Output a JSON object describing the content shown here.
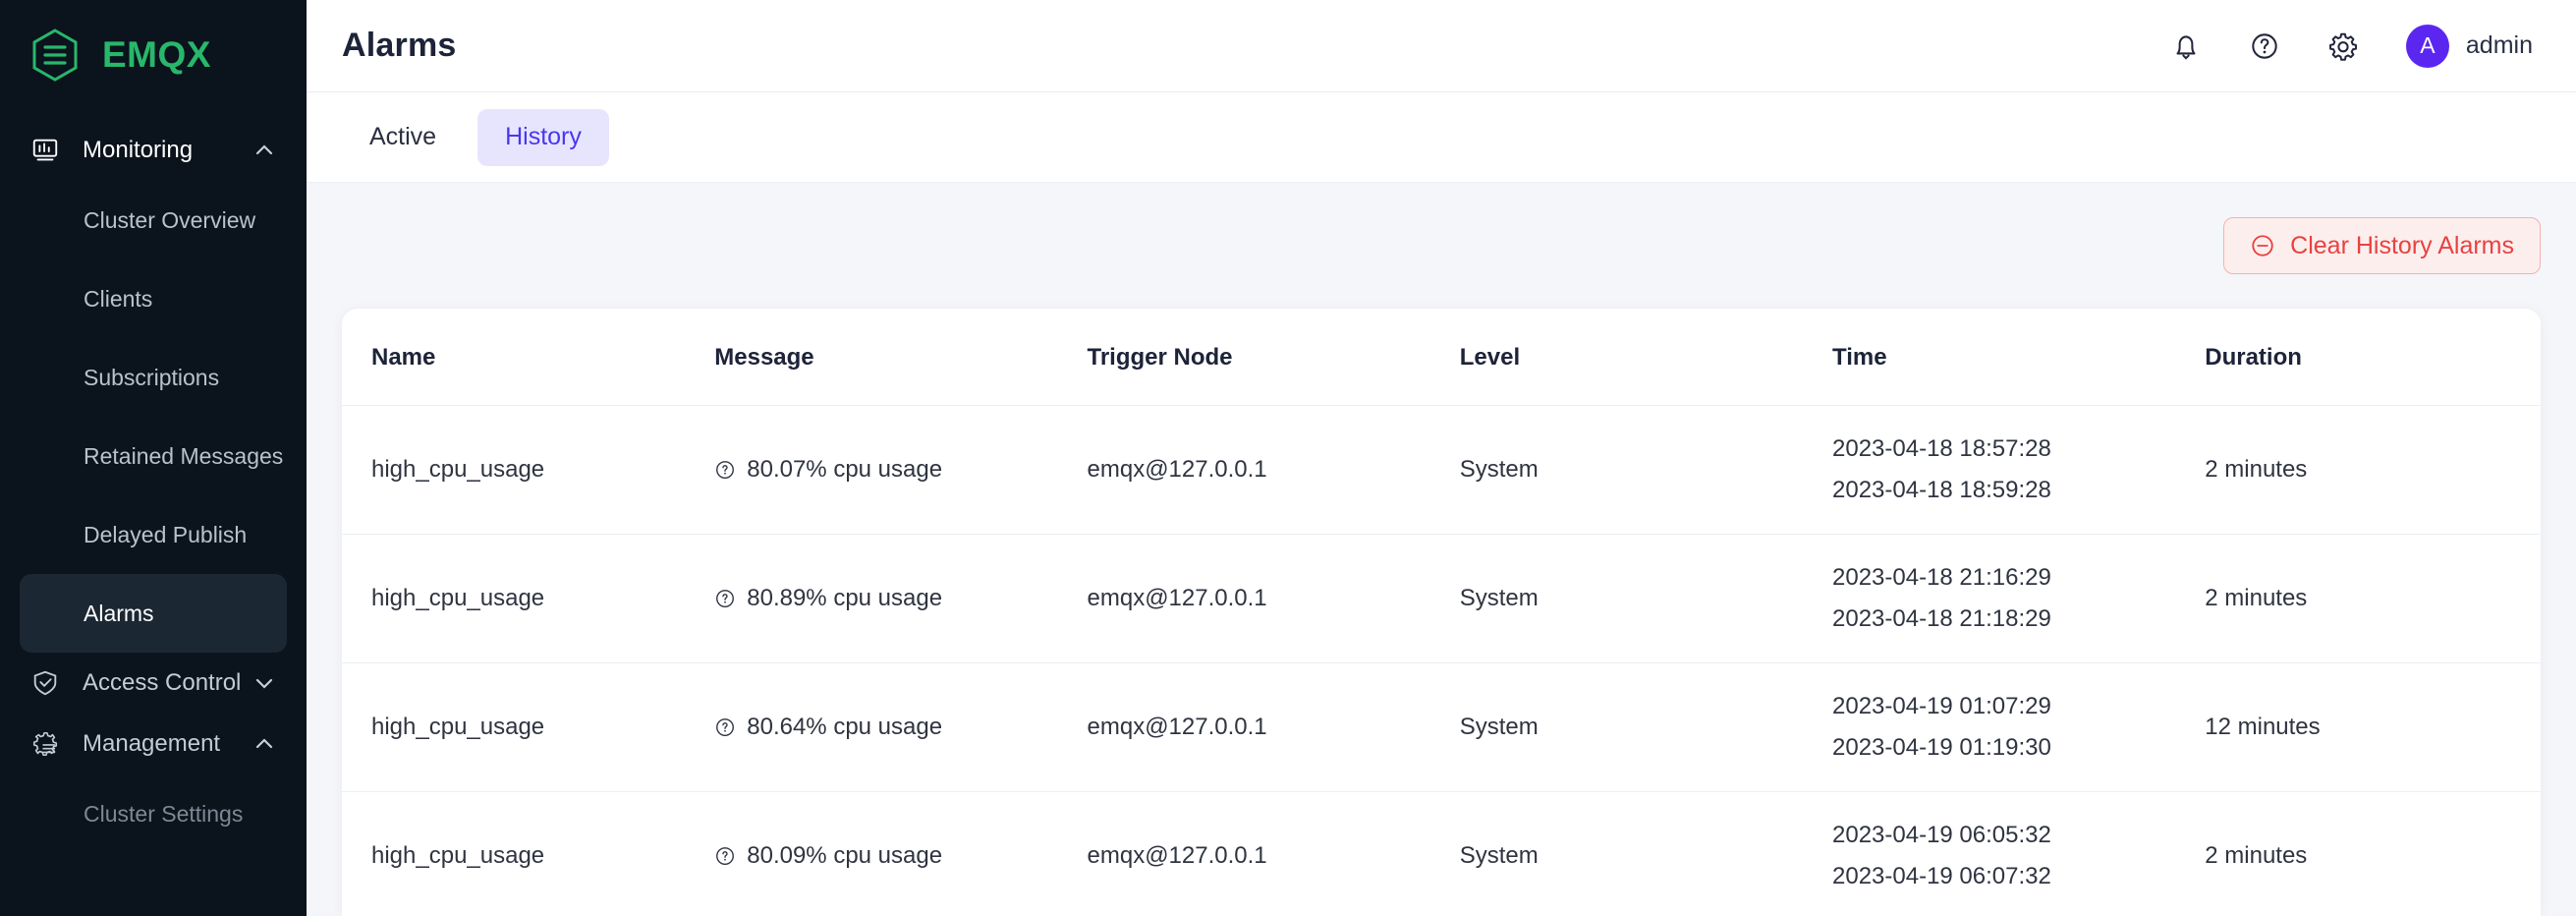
{
  "brand": {
    "name": "EMQX",
    "logo_icon": "emqx-hexagon-logo",
    "accent_color": "#28b76b"
  },
  "sidebar": {
    "background_color": "#0b131d",
    "active_item_color": "#1b2733",
    "groups": [
      {
        "label": "Monitoring",
        "icon": "monitor-chart-icon",
        "chevron": "chevron-up-icon",
        "expanded": true,
        "items": [
          {
            "label": "Cluster Overview",
            "active": false
          },
          {
            "label": "Clients",
            "active": false
          },
          {
            "label": "Subscriptions",
            "active": false
          },
          {
            "label": "Retained Messages",
            "active": false
          },
          {
            "label": "Delayed Publish",
            "active": false
          },
          {
            "label": "Alarms",
            "active": true
          }
        ]
      },
      {
        "label": "Access Control",
        "icon": "shield-check-icon",
        "chevron": "chevron-down-icon",
        "expanded": false,
        "items": []
      },
      {
        "label": "Management",
        "icon": "gear-list-icon",
        "chevron": "chevron-up-icon",
        "expanded": true,
        "items": [
          {
            "label": "Cluster Settings",
            "active": false,
            "muted": true
          }
        ]
      }
    ]
  },
  "header": {
    "title": "Alarms",
    "icons": [
      {
        "name": "bell-icon"
      },
      {
        "name": "help-circle-icon"
      },
      {
        "name": "gear-icon"
      }
    ],
    "user": {
      "initial": "A",
      "name": "admin",
      "avatar_color": "#5b27f0"
    }
  },
  "tabs": [
    {
      "label": "Active",
      "active": false
    },
    {
      "label": "History",
      "active": true
    }
  ],
  "toolbar": {
    "clear_button": {
      "label": "Clear History Alarms",
      "icon": "minus-circle-icon",
      "text_color": "#e8423f",
      "background_color": "#fdeeee",
      "border_color": "#f6b0ae"
    }
  },
  "table": {
    "columns": [
      "Name",
      "Message",
      "Trigger Node",
      "Level",
      "Time",
      "Duration"
    ],
    "rows": [
      {
        "name": "high_cpu_usage",
        "message_icon": "help-circle-icon",
        "message": "80.07% cpu usage",
        "trigger_node": "emqx@127.0.0.1",
        "level": "System",
        "time_start": "2023-04-18 18:57:28",
        "time_end": "2023-04-18 18:59:28",
        "duration": "2 minutes"
      },
      {
        "name": "high_cpu_usage",
        "message_icon": "help-circle-icon",
        "message": "80.89% cpu usage",
        "trigger_node": "emqx@127.0.0.1",
        "level": "System",
        "time_start": "2023-04-18 21:16:29",
        "time_end": "2023-04-18 21:18:29",
        "duration": "2 minutes"
      },
      {
        "name": "high_cpu_usage",
        "message_icon": "help-circle-icon",
        "message": "80.64% cpu usage",
        "trigger_node": "emqx@127.0.0.1",
        "level": "System",
        "time_start": "2023-04-19 01:07:29",
        "time_end": "2023-04-19 01:19:30",
        "duration": "12 minutes"
      },
      {
        "name": "high_cpu_usage",
        "message_icon": "help-circle-icon",
        "message": "80.09% cpu usage",
        "trigger_node": "emqx@127.0.0.1",
        "level": "System",
        "time_start": "2023-04-19 06:05:32",
        "time_end": "2023-04-19 06:07:32",
        "duration": "2 minutes"
      }
    ]
  }
}
